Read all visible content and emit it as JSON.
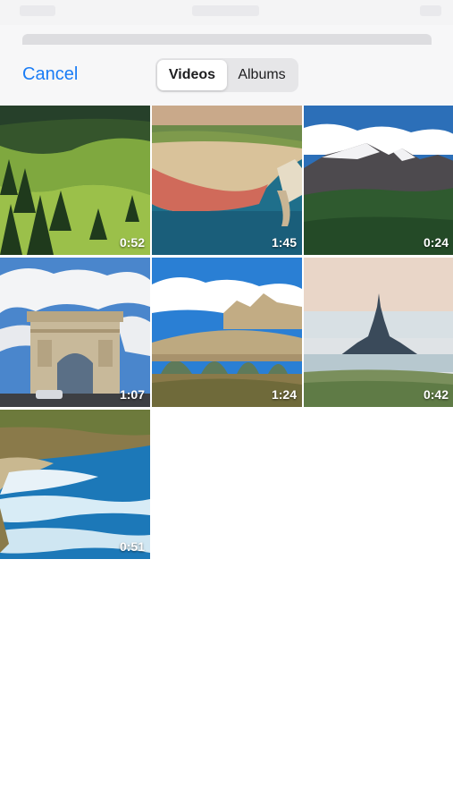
{
  "header": {
    "cancel_label": "Cancel",
    "tabs": [
      {
        "label": "Videos",
        "active": true
      },
      {
        "label": "Albums",
        "active": false
      }
    ]
  },
  "videos": [
    {
      "duration": "0:52",
      "subject": "green alpine hills with pine trees"
    },
    {
      "duration": "1:45",
      "subject": "white chalk cliffs with sea arch"
    },
    {
      "duration": "0:24",
      "subject": "snowy mountain range"
    },
    {
      "duration": "1:07",
      "subject": "arc de triomphe"
    },
    {
      "duration": "1:24",
      "subject": "stone arch bridge with hilltop cathedral"
    },
    {
      "duration": "0:42",
      "subject": "mont saint-michel island at low tide"
    },
    {
      "duration": "0:51",
      "subject": "rocky coastline with waves"
    }
  ],
  "colors": {
    "accent": "#1a7cf5",
    "header_bg": "#f7f7f8",
    "segment_bg": "#e6e6e8"
  }
}
